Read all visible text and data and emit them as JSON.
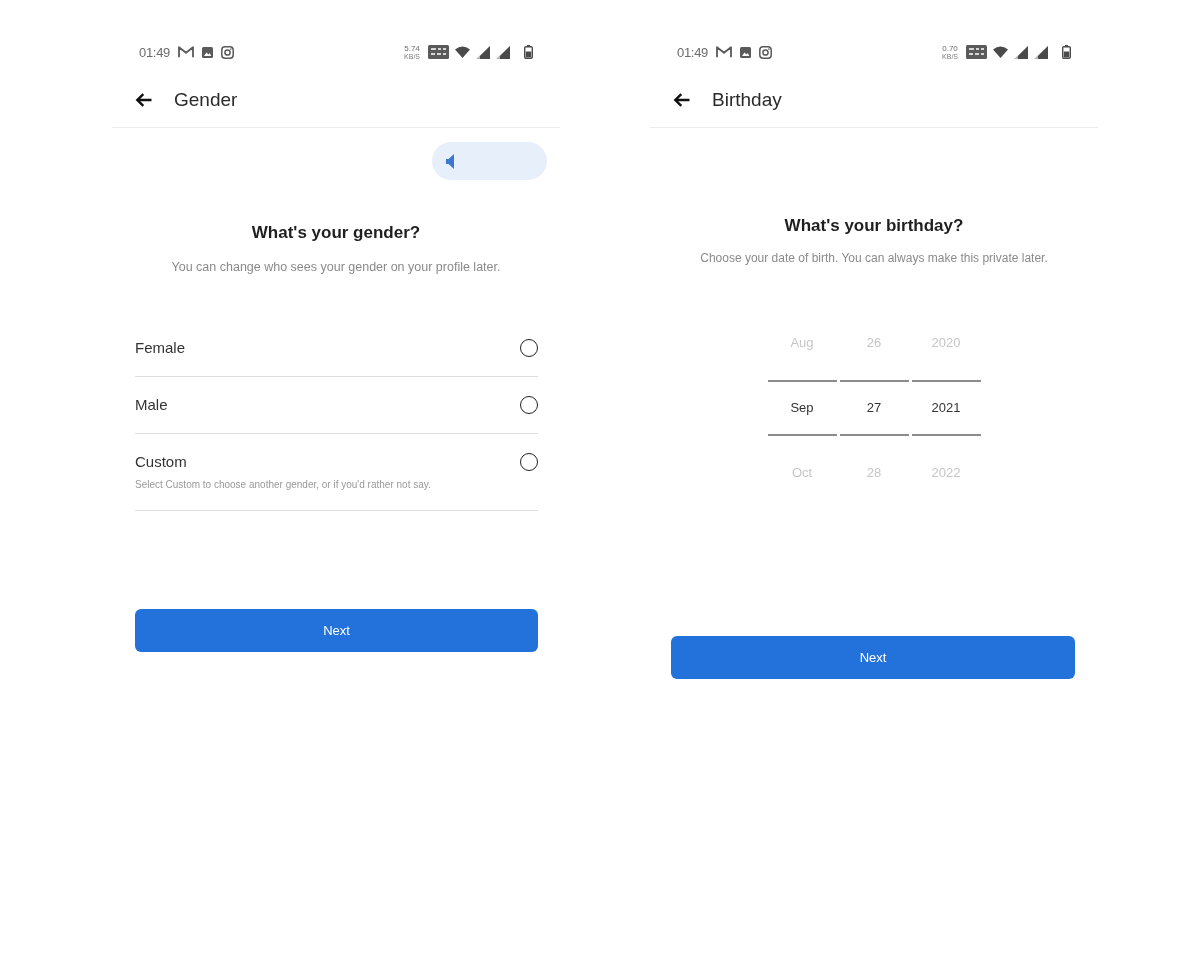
{
  "screens": [
    {
      "kind": "gender",
      "status_bar": {
        "time": "01:49",
        "net_speed": "5.74",
        "net_speed_unit": "KB/S"
      },
      "header": {
        "title": "Gender"
      },
      "heading": "What's your gender?",
      "subtitle": "You can change who sees your gender on your profile later.",
      "options": [
        {
          "label": "Female",
          "selected": false
        },
        {
          "label": "Male",
          "selected": false
        },
        {
          "label": "Custom",
          "description": "Select Custom to choose another gender, or if you'd rather not say.",
          "selected": false
        }
      ],
      "button": "Next"
    },
    {
      "kind": "birthday",
      "status_bar": {
        "time": "01:49",
        "net_speed": "0.70",
        "net_speed_unit": "KB/S"
      },
      "header": {
        "title": "Birthday"
      },
      "heading": "What's your birthday?",
      "subtitle": "Choose your date of birth. You can always make this private later.",
      "picker": {
        "columns": [
          {
            "options": [
              {
                "label": "Aug",
                "selected": false
              },
              {
                "label": "Sep",
                "selected": true
              },
              {
                "label": "Oct",
                "selected": false
              }
            ]
          },
          {
            "options": [
              {
                "label": "26",
                "selected": false
              },
              {
                "label": "27",
                "selected": true
              },
              {
                "label": "28",
                "selected": false
              }
            ]
          },
          {
            "options": [
              {
                "label": "2020",
                "selected": false
              },
              {
                "label": "2021",
                "selected": true
              },
              {
                "label": "2022",
                "selected": false
              }
            ]
          }
        ]
      },
      "button": "Next"
    }
  ]
}
